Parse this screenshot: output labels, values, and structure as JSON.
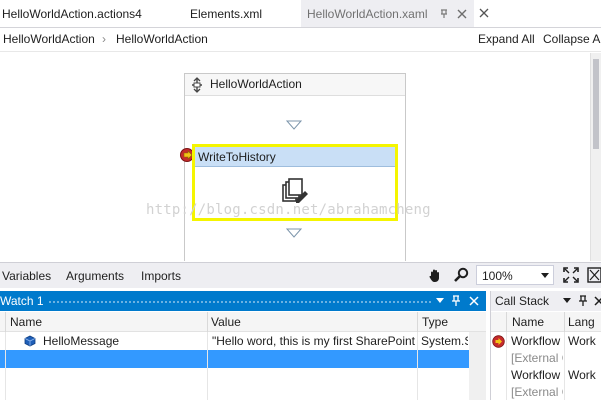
{
  "tabs": [
    {
      "label": "HelloWorldAction.actions4"
    },
    {
      "label": "Elements.xml"
    },
    {
      "label": "HelloWorldAction.xaml"
    }
  ],
  "breadcrumb": {
    "items": [
      "HelloWorldAction",
      "HelloWorldAction"
    ],
    "separator": "›",
    "expand_all": "Expand All",
    "collapse_all": "Collapse All"
  },
  "designer": {
    "sequence_title": "HelloWorldAction",
    "activity_title": "WriteToHistory",
    "watermark": "http://blog.csdn.net/abrahamcheng",
    "selection_color": "#f5f500",
    "activity_header_color": "#c9dff6"
  },
  "designer_bar": {
    "tabs": [
      "Variables",
      "Arguments",
      "Imports"
    ],
    "zoom": "100%"
  },
  "watch": {
    "title": "Watch 1",
    "columns": [
      "Name",
      "Value",
      "Type"
    ],
    "rows": [
      {
        "name": "HelloMessage",
        "value": "\"Hello word, this is my first SharePoint",
        "type": "System.S"
      }
    ],
    "accent": "#007acc",
    "selected_row_color": "#3399ff"
  },
  "callstack": {
    "title": "Call Stack",
    "columns": [
      "Name",
      "Lang"
    ],
    "rows": [
      {
        "name": "Workflow",
        "lang": "Work"
      },
      {
        "name": "[External C",
        "lang": ""
      },
      {
        "name": "Workflow",
        "lang": "Work"
      },
      {
        "name": "[External C",
        "lang": ""
      }
    ]
  }
}
